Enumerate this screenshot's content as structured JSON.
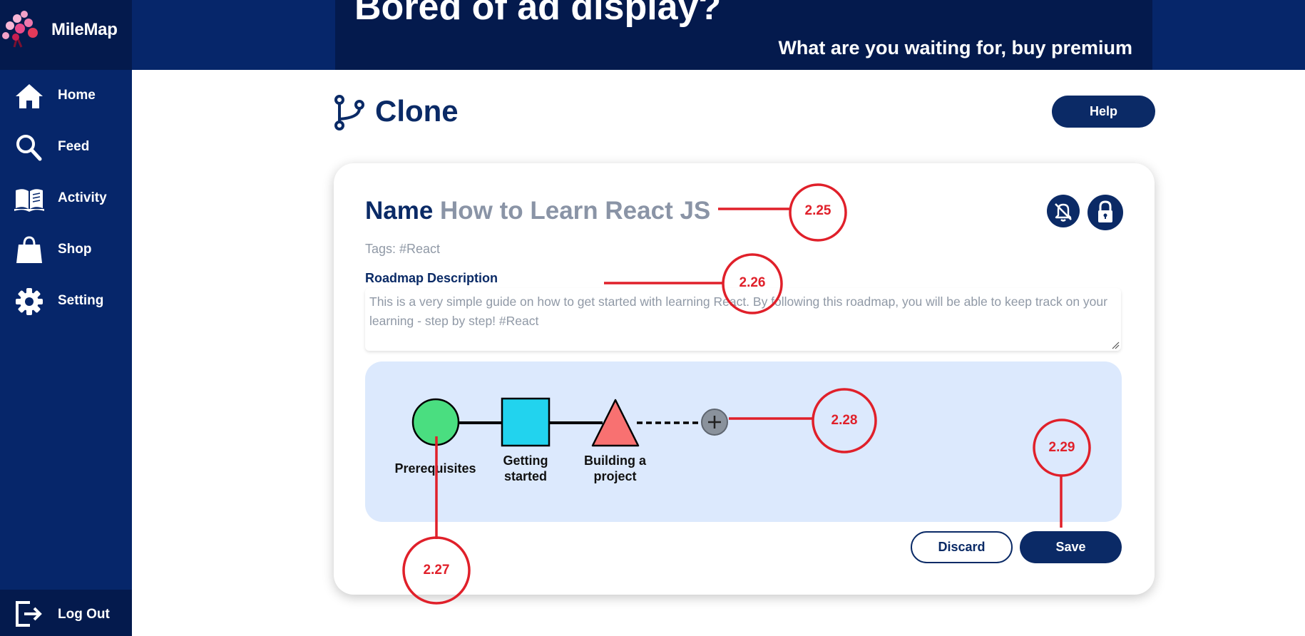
{
  "app": {
    "name": "MileMap"
  },
  "sidebar": {
    "items": [
      {
        "label": "Home",
        "icon": "home-icon"
      },
      {
        "label": "Feed",
        "icon": "search-icon"
      },
      {
        "label": "Activity",
        "icon": "book-icon"
      },
      {
        "label": "Shop",
        "icon": "shopping-bag-icon"
      },
      {
        "label": "Setting",
        "icon": "gear-icon"
      }
    ],
    "logout_label": "Log Out"
  },
  "ad": {
    "title": "Bored of ad display?",
    "subtitle": "What are you waiting for, buy premium"
  },
  "header": {
    "title": "Clone",
    "help_label": "Help"
  },
  "form": {
    "name_label": "Name",
    "name_value": "How to Learn React JS",
    "tags": "Tags: #React",
    "description_label": "Roadmap Description",
    "description_value": "This is a very simple guide on how to get started with learning React. By following this roadmap, you will be able to keep track on your learning - step by step! #React"
  },
  "roadmap": {
    "nodes": [
      {
        "label": "Prerequisites",
        "shape": "circle",
        "color": "#4ade80"
      },
      {
        "label": "Getting started",
        "label_line1": "Getting",
        "label_line2": "started",
        "shape": "square",
        "color": "#22d3ee"
      },
      {
        "label": "Building a project",
        "label_line1": "Building a",
        "label_line2": "project",
        "shape": "triangle",
        "color": "#f87171"
      }
    ],
    "add_icon": "plus-icon"
  },
  "actions": {
    "discard_label": "Discard",
    "save_label": "Save"
  },
  "annotations": [
    "2.25",
    "2.26",
    "2.27",
    "2.28",
    "2.29"
  ],
  "colors": {
    "sidebar": "#06266a",
    "brand_dark": "#041a4d",
    "primary": "#0b2a66",
    "roadmap_bg": "#dce9fd",
    "annotation": "#e0202a"
  }
}
